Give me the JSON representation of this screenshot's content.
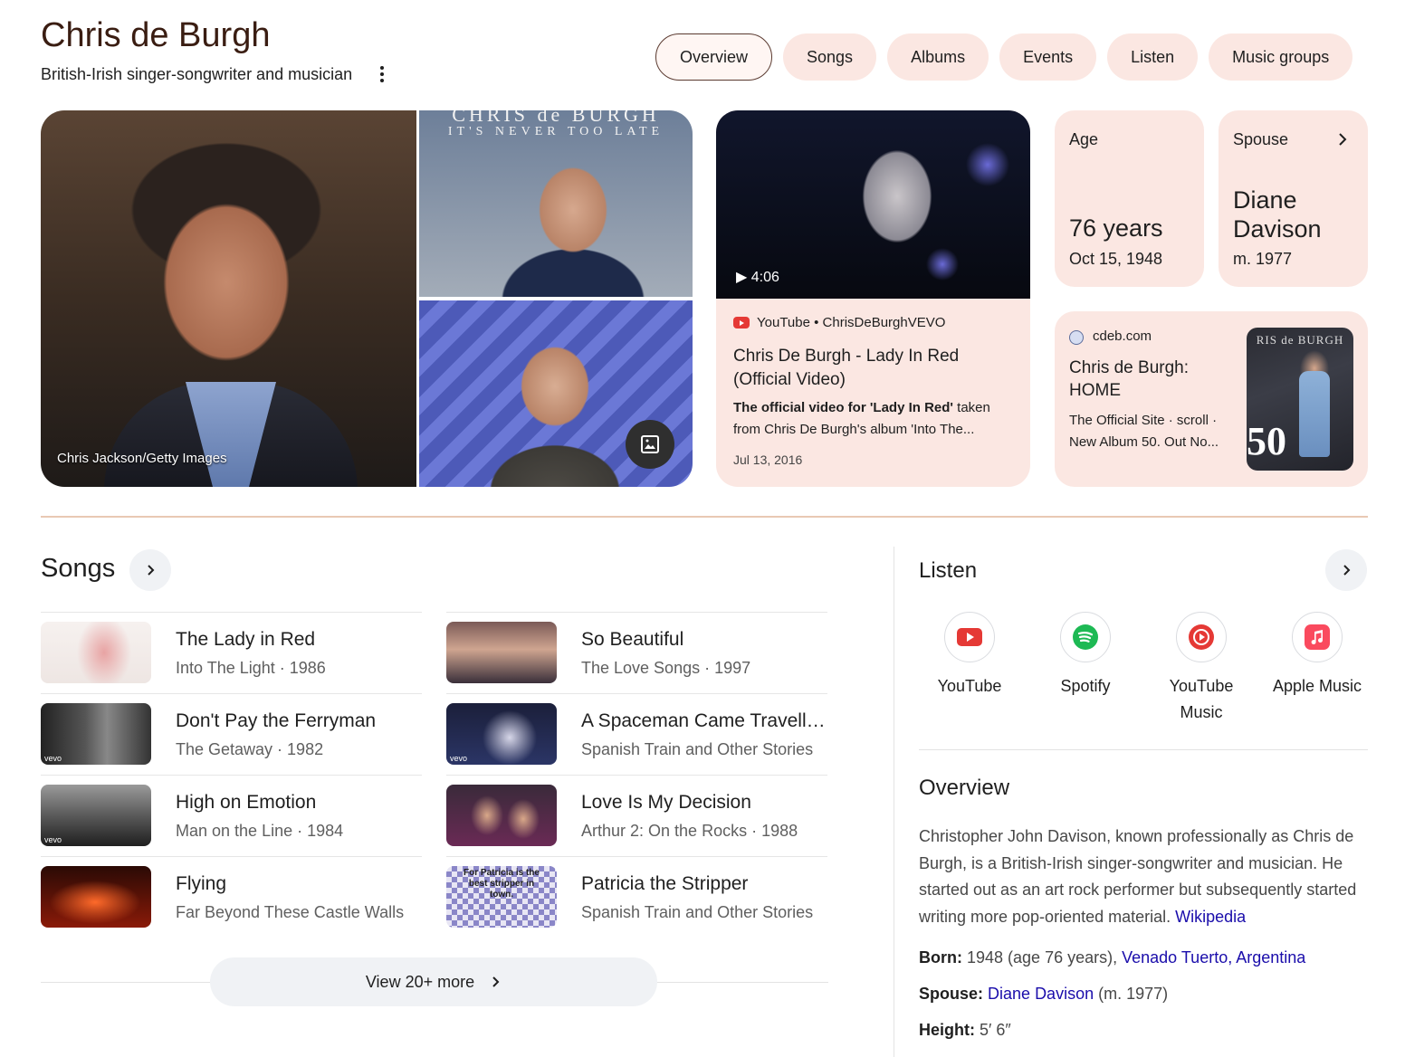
{
  "header": {
    "title": "Chris de Burgh",
    "subtitle": "British-Irish singer-songwriter and musician"
  },
  "tabs": [
    {
      "label": "Overview",
      "active": true
    },
    {
      "label": "Songs"
    },
    {
      "label": "Albums"
    },
    {
      "label": "Events"
    },
    {
      "label": "Listen"
    },
    {
      "label": "Music groups"
    }
  ],
  "images": {
    "credit": "Chris Jackson/Getty Images",
    "album_title": "CHRIS de BURGH",
    "album_subtitle": "IT'S NEVER TOO LATE"
  },
  "video": {
    "duration": "▶ 4:06",
    "source": "YouTube • ChrisDeBurghVEVO",
    "title": "Chris De Burgh - Lady In Red (Official Video)",
    "snippet_bold_1": "The official video for 'Lady In Red'",
    "snippet_rest": " taken from Chris De Burgh's album 'Into The...",
    "date": "Jul 13, 2016"
  },
  "stats": {
    "age": {
      "label": "Age",
      "value": "76 years",
      "sub": "Oct 15, 1948"
    },
    "spouse": {
      "label": "Spouse",
      "value_line1": "Diane",
      "value_line2": "Davison",
      "sub": "m. 1977"
    }
  },
  "site": {
    "domain": "cdeb.com",
    "title": "Chris de Burgh: HOME",
    "snippet": "The Official Site · scroll · New Album 50. Out No...",
    "thumb_text": "RIS de BURGH",
    "thumb_number": "50"
  },
  "songs": {
    "title": "Songs",
    "items": [
      {
        "title": "The Lady in Red",
        "sub": "Into The Light · 1986"
      },
      {
        "title": "So Beautiful",
        "sub": "The Love Songs · 1997"
      },
      {
        "title": "Don't Pay the Ferryman",
        "sub": "The Getaway · 1982"
      },
      {
        "title": "A Spaceman Came Travelling",
        "sub": "Spanish Train and Other Stories"
      },
      {
        "title": "High on Emotion",
        "sub": "Man on the Line · 1984"
      },
      {
        "title": "Love Is My Decision",
        "sub": "Arthur 2: On the Rocks · 1988"
      },
      {
        "title": "Flying",
        "sub": "Far Beyond These Castle Walls"
      },
      {
        "title": "Patricia the Stripper",
        "sub": "Spanish Train and Other Stories"
      }
    ],
    "thumb_labels": {
      "vevo": "vevo",
      "patricia": "For Patricia is the best stripper in town."
    },
    "view_more": "View 20+ more"
  },
  "listen": {
    "title": "Listen",
    "items": [
      {
        "label": "YouTube",
        "icon": "youtube-icon",
        "color": "#e53935"
      },
      {
        "label": "Spotify",
        "icon": "spotify-icon",
        "color": "#1db954"
      },
      {
        "label": "YouTube Music",
        "icon": "youtube-music-icon",
        "color": "#e53935"
      },
      {
        "label": "Apple Music",
        "icon": "apple-music-icon",
        "color": "#fa4a5e"
      }
    ]
  },
  "overview": {
    "title": "Overview",
    "text": "Christopher John Davison, known professionally as Chris de Burgh, is a British-Irish singer-songwriter and musician. He started out as an art rock performer but subsequently started writing more pop-oriented material.",
    "source": "Wikipedia",
    "facts": {
      "born_label": "Born:",
      "born_value": " 1948 (age 76 years), ",
      "born_link": "Venado Tuerto, Argentina",
      "spouse_label": "Spouse:",
      "spouse_link": "Diane Davison",
      "spouse_value": " (m. 1977)",
      "height_label": "Height:",
      "height_value": " 5′ 6″"
    }
  },
  "colors": {
    "accent_card": "#fbe7e2",
    "title_brown": "#3a1d12",
    "link": "#1a0dab"
  }
}
